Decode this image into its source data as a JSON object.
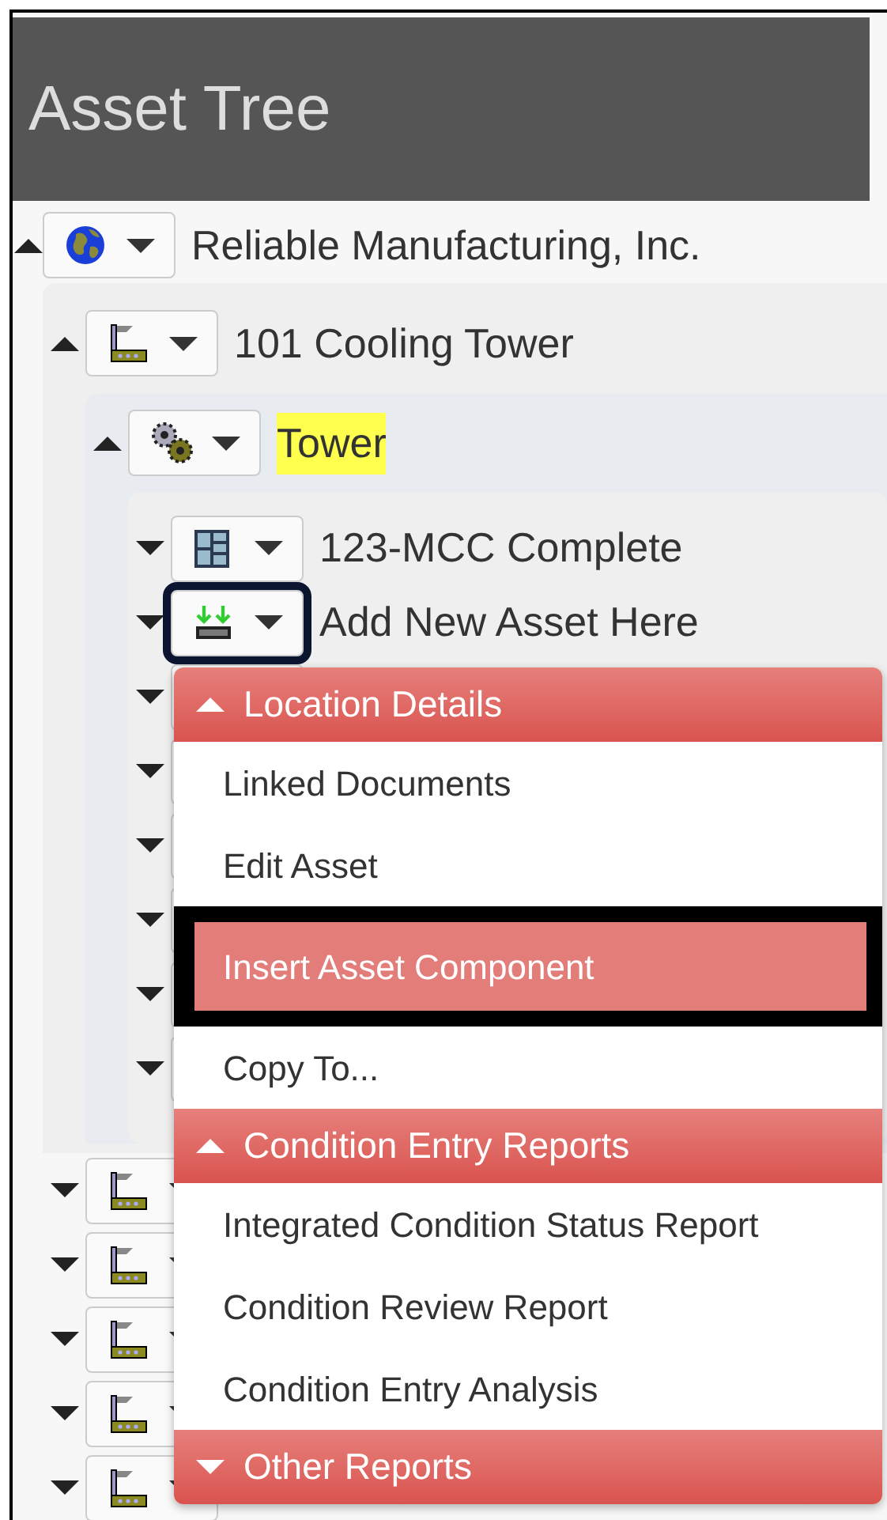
{
  "panel": {
    "title": "Asset Tree"
  },
  "tree": {
    "label": "Reliable Manufacturing, Inc.",
    "kind": "globe",
    "expanded": true,
    "children": [
      {
        "label": "101 Cooling Tower",
        "kind": "factory",
        "expanded": true,
        "children": [
          {
            "label": "Tower",
            "kind": "gears",
            "expanded": true,
            "highlighted": true,
            "children": [
              {
                "label": "123-MCC Complete",
                "kind": "cabinet",
                "expanded": false
              },
              {
                "label": "Add New Asset Here",
                "kind": "add",
                "expanded": false,
                "focused": true
              },
              {
                "kind": "blank",
                "expanded": false
              },
              {
                "kind": "blank",
                "expanded": false
              },
              {
                "kind": "blank",
                "expanded": false
              },
              {
                "kind": "blank",
                "expanded": false
              },
              {
                "kind": "blank",
                "expanded": false
              },
              {
                "kind": "blank",
                "expanded": false
              }
            ]
          }
        ]
      },
      {
        "kind": "factory",
        "expanded": false
      },
      {
        "kind": "factory",
        "expanded": false
      },
      {
        "kind": "factory",
        "expanded": false
      },
      {
        "kind": "factory",
        "expanded": false
      },
      {
        "kind": "factory",
        "expanded": false
      }
    ]
  },
  "context_menu": {
    "sections": [
      {
        "title": "Location Details",
        "expanded": true,
        "items": [
          {
            "label": "Linked Documents",
            "selected": false
          },
          {
            "label": "Edit Asset",
            "selected": false
          },
          {
            "label": "Insert Asset Component",
            "selected": true
          },
          {
            "label": "Copy To...",
            "selected": false
          }
        ]
      },
      {
        "title": "Condition Entry Reports",
        "expanded": true,
        "items": [
          {
            "label": "Integrated Condition Status Report",
            "selected": false
          },
          {
            "label": "Condition Review Report",
            "selected": false
          },
          {
            "label": "Condition Entry Analysis",
            "selected": false
          }
        ]
      },
      {
        "title": "Other Reports",
        "expanded": false
      }
    ]
  }
}
